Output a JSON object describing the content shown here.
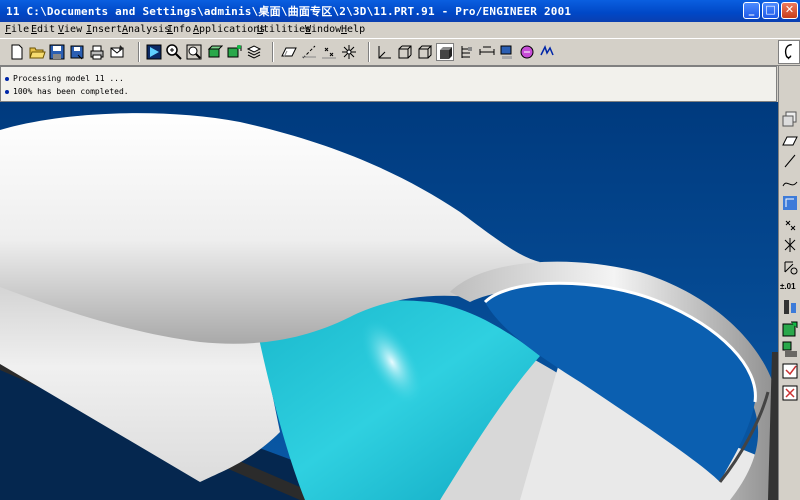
{
  "window": {
    "title": "11  C:\\Documents and Settings\\adminis\\桌面\\曲面专区\\2\\3D\\11.PRT.91 - Pro/ENGINEER 2001",
    "minimize_glyph": "_",
    "maximize_glyph": "□",
    "close_glyph": "✕"
  },
  "menubar": {
    "items": [
      {
        "label": "File",
        "mnemonic": "F"
      },
      {
        "label": "Edit",
        "mnemonic": "E"
      },
      {
        "label": "View",
        "mnemonic": "V"
      },
      {
        "label": "Insert",
        "mnemonic": "I"
      },
      {
        "label": "Analysis",
        "mnemonic": "A"
      },
      {
        "label": "Info",
        "mnemonic": "I"
      },
      {
        "label": "Applications",
        "mnemonic": "A"
      },
      {
        "label": "Utilities",
        "mnemonic": "U"
      },
      {
        "label": "Window",
        "mnemonic": "W"
      },
      {
        "label": "Help",
        "mnemonic": "H"
      }
    ]
  },
  "toolbar": {
    "icons": [
      "new-icon",
      "open-icon",
      "save-icon",
      "save-copy-icon",
      "print-icon",
      "send-mail-icon",
      "repaint-icon",
      "zoom-in-icon",
      "zoom-fit-icon",
      "orient-icon",
      "named-view-icon",
      "layers-icon",
      "datum-plane-display-icon",
      "datum-axis-display-icon",
      "datum-point-display-icon",
      "wireframe-icon",
      "hidden-line-icon",
      "no-hidden-icon",
      "shaded-icon",
      "spin-center-icon",
      "model-tree-icon",
      "info-icon",
      "help-icon",
      "whats-this-icon"
    ]
  },
  "messages": [
    {
      "text": "Processing model 11 ..."
    },
    {
      "text": "100% has been completed."
    }
  ],
  "rightbar": {
    "icons": [
      "surface-copy-icon",
      "datum-plane-tool-icon",
      "datum-axis-tool-icon",
      "datum-curve-tool-icon",
      "datum-coord-sys-icon",
      "datum-point-icon",
      "offset-point-icon",
      "sketch-icon",
      "dimension-tolerance-icon",
      "relations-icon",
      "regenerate-icon",
      "feature-list-icon",
      "done-icon",
      "quit-icon"
    ],
    "tolerance_label": "±.01"
  },
  "colors": {
    "titlebar": "#0047c6",
    "viewport_bg": "#003f87",
    "surface_white": "#f2f2f2",
    "surface_highlight": "#22c7d8",
    "chrome": "#d4d0c8"
  }
}
